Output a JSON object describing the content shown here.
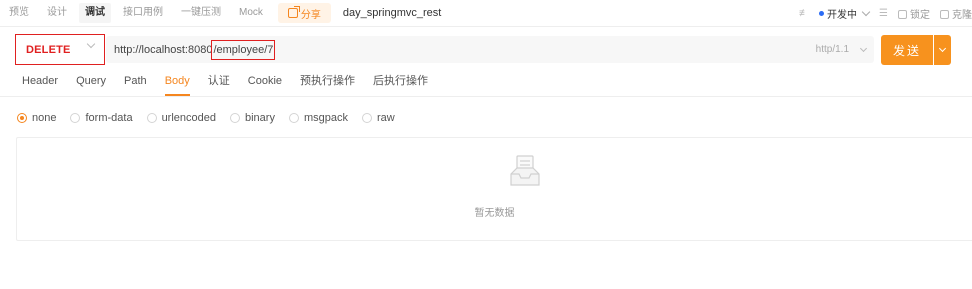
{
  "top_tabs": [
    {
      "label": "预览"
    },
    {
      "label": "设计"
    },
    {
      "label": "调试"
    },
    {
      "label": "接口用例"
    },
    {
      "label": "一键压测"
    },
    {
      "label": "Mock"
    }
  ],
  "share_label": "分享",
  "api_name": "day_springmvc_rest",
  "top_right": {
    "environment": "开发中",
    "lock_label": "锁定",
    "clone_label": "克隆"
  },
  "request": {
    "method": "DELETE",
    "url_base": "http://localhost:8080",
    "url_path": "/employee/7",
    "http_version": "http/1.1",
    "send_label": "发送"
  },
  "request_tabs": [
    {
      "label": "Header"
    },
    {
      "label": "Query"
    },
    {
      "label": "Path"
    },
    {
      "label": "Body"
    },
    {
      "label": "认证"
    },
    {
      "label": "Cookie"
    },
    {
      "label": "预执行操作"
    },
    {
      "label": "后执行操作"
    }
  ],
  "body_types": [
    {
      "label": "none"
    },
    {
      "label": "form-data"
    },
    {
      "label": "urlencoded"
    },
    {
      "label": "binary"
    },
    {
      "label": "msgpack"
    },
    {
      "label": "raw"
    }
  ],
  "selected_body_type": "none",
  "empty_text": "暂无数据",
  "colors": {
    "accent": "#f5861f",
    "send_button": "#f7921e",
    "highlight_border": "#e02020"
  }
}
